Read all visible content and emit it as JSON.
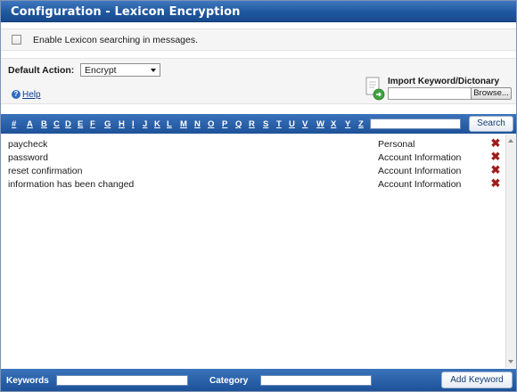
{
  "window": {
    "title": "Configuration - Lexicon Encryption"
  },
  "enable": {
    "label": "Enable Lexicon searching in messages.",
    "checked": false
  },
  "settings": {
    "default_action_label": "Default Action:",
    "default_action_value": "Encrypt",
    "help_label": "Help",
    "import_label": "Import Keyword/Dictonary",
    "import_value": "",
    "browse_label": "Browse..."
  },
  "alpha": {
    "letters": [
      "#",
      "A",
      "B",
      "C",
      "D",
      "E",
      "F",
      "G",
      "H",
      "I",
      "J",
      "K",
      "L",
      "M",
      "N",
      "O",
      "P",
      "Q",
      "R",
      "S",
      "T",
      "U",
      "V",
      "W",
      "X",
      "Y",
      "Z"
    ],
    "search_value": "",
    "search_label": "Search"
  },
  "keywords": [
    {
      "keyword": "paycheck",
      "category": "Personal"
    },
    {
      "keyword": "password",
      "category": "Account Information"
    },
    {
      "keyword": "reset confirmation",
      "category": "Account Information"
    },
    {
      "keyword": "information has been changed",
      "category": "Account Information"
    }
  ],
  "footer": {
    "keywords_label": "Keywords",
    "keywords_value": "",
    "category_label": "Category",
    "category_value": "",
    "add_label": "Add Keyword"
  },
  "icons": {
    "delete": "delete-x-icon",
    "help": "help-icon",
    "import": "import-document-icon"
  },
  "colors": {
    "header_blue": "#1f579f",
    "delete_red": "#9e1c1c",
    "link_blue": "#0a3d91"
  }
}
